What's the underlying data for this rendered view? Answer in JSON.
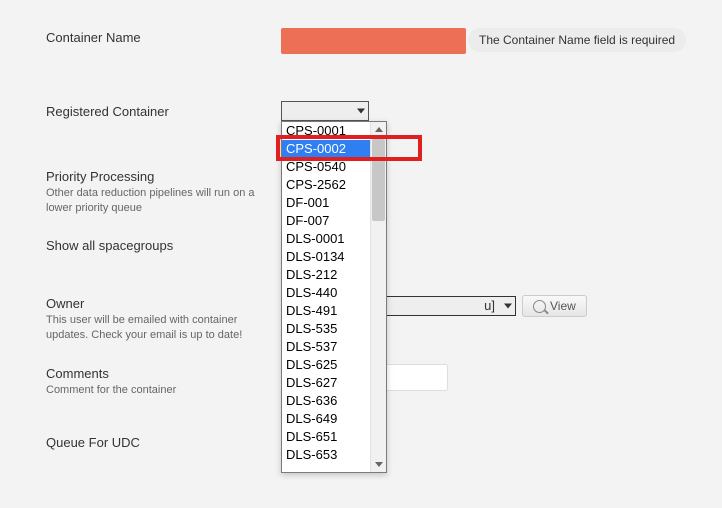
{
  "container_name": {
    "label": "Container Name",
    "value": "",
    "error": "The Container Name field is required"
  },
  "registered_container": {
    "label": "Registered Container",
    "selected": "",
    "highlighted_index": 1,
    "options": [
      "CPS-0001",
      "CPS-0002",
      "CPS-0540",
      "CPS-2562",
      "DF-001",
      "DF-007",
      "DLS-0001",
      "DLS-0134",
      "DLS-212",
      "DLS-440",
      "DLS-491",
      "DLS-535",
      "DLS-537",
      "DLS-625",
      "DLS-627",
      "DLS-636",
      "DLS-649",
      "DLS-651",
      "DLS-653"
    ]
  },
  "priority": {
    "label": "Priority Processing",
    "help": "Other data reduction pipelines will run on a lower priority queue"
  },
  "spacegroups": {
    "label": "Show all spacegroups"
  },
  "owner": {
    "label": "Owner",
    "help": "This user will be emailed with container updates. Check your email is up to date!",
    "value_fragment": "u]",
    "view_label": "View"
  },
  "comments": {
    "label": "Comments",
    "help": "Comment for the container"
  },
  "queue": {
    "label": "Queue For UDC"
  },
  "icons": {
    "search": "🔍"
  }
}
